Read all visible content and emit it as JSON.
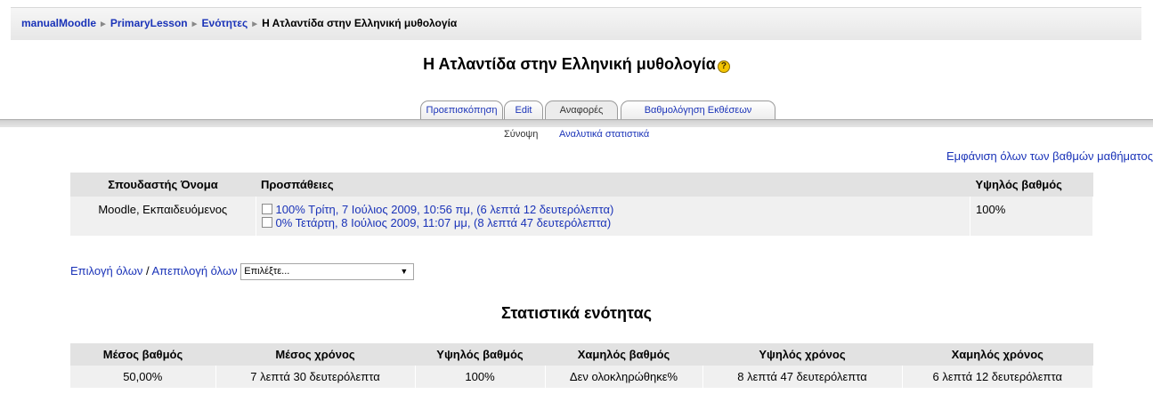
{
  "breadcrumb": {
    "items": [
      "manualMoodle",
      "PrimaryLesson",
      "Ενότητες"
    ],
    "current": "Η Ατλαντίδα στην Ελληνική μυθολογία",
    "separator": "►"
  },
  "page_title": "Η Ατλαντίδα στην Ελληνική μυθολογία",
  "help_icon": "?",
  "tabs": [
    {
      "label": "Προεπισκόπηση",
      "selected": false
    },
    {
      "label": "Edit",
      "selected": false
    },
    {
      "label": "Αναφορές",
      "selected": true
    },
    {
      "label": "Βαθμολόγηση Εκθέσεων",
      "selected": false
    }
  ],
  "subtabs": {
    "summary": "Σύνοψη",
    "detailed": "Αναλυτικά στατιστικά"
  },
  "show_all_grades": "Εμφάνιση όλων των βαθμών μαθήματος",
  "attempts_table": {
    "headers": {
      "student": "Σπουδαστής Όνομα",
      "attempts": "Προσπάθειες",
      "high_score": "Υψηλός βαθμός"
    },
    "rows": [
      {
        "student": "Moodle, Εκπαιδευόμενος",
        "attempts": [
          "100% Τρίτη, 7 Ιούλιος 2009, 10:56 πμ, (6 λεπτά 12 δευτερόλεπτα)",
          "0% Τετάρτη, 8 Ιούλιος 2009, 11:07 μμ, (8 λεπτά 47 δευτερόλεπτα)"
        ],
        "high_score": "100%"
      }
    ]
  },
  "selection": {
    "select_all": "Επιλογή όλων",
    "divider": "/",
    "deselect_all": "Απεπιλογή όλων",
    "dropdown_value": "Επιλέξτε..."
  },
  "stats_title": "Στατιστικά ενότητας",
  "stats_table": {
    "headers": [
      "Μέσος βαθμός",
      "Μέσος χρόνος",
      "Υψηλός βαθμός",
      "Χαμηλός βαθμός",
      "Υψηλός χρόνος",
      "Χαμηλός χρόνος"
    ],
    "values": [
      "50,00%",
      "7 λεπτά 30 δευτερόλεπτα",
      "100%",
      "Δεν ολοκληρώθηκε%",
      "8 λεπτά 47 δευτερόλεπτα",
      "6 λεπτά 12 δευτερόλεπτα"
    ]
  },
  "colors": {
    "link": "#1a33b8",
    "header_bg": "#e2e2e2",
    "cell_bg": "#f0f0f0",
    "help_icon": "#f3c400"
  }
}
